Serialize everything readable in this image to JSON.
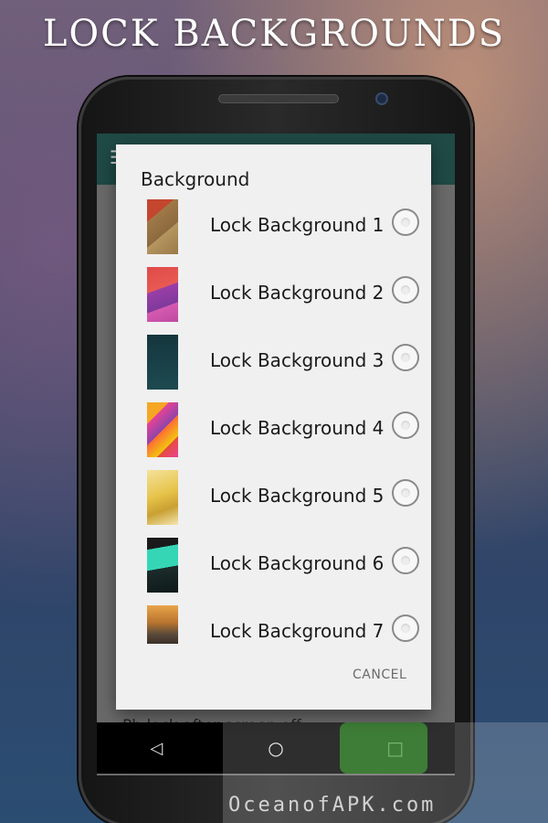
{
  "promo": {
    "title": "LOCK BACKGROUNDS"
  },
  "app": {
    "background_setting_text": "Pb lock after screen off"
  },
  "dialog": {
    "title": "Background",
    "options": [
      {
        "label": "Lock Background 1",
        "thumbnail": "thumb-1",
        "selected": false
      },
      {
        "label": "Lock Background 2",
        "thumbnail": "thumb-2",
        "selected": false
      },
      {
        "label": "Lock Background 3",
        "thumbnail": "thumb-3",
        "selected": false
      },
      {
        "label": "Lock Background 4",
        "thumbnail": "thumb-4",
        "selected": false
      },
      {
        "label": "Lock Background 5",
        "thumbnail": "thumb-5",
        "selected": false
      },
      {
        "label": "Lock Background 6",
        "thumbnail": "thumb-6",
        "selected": false
      },
      {
        "label": "Lock Background 7",
        "thumbnail": "thumb-7",
        "selected": false
      }
    ],
    "cancel_label": "CANCEL"
  },
  "nav": {
    "back": "◁",
    "home": "○",
    "recents": "□"
  },
  "watermark": {
    "text": "OceanofAPK.com",
    "logo_text": "APK"
  },
  "colors": {
    "toolbar": "#1f4a45",
    "dialog": "#f0f0f1",
    "accent": "#6b6b6b"
  }
}
